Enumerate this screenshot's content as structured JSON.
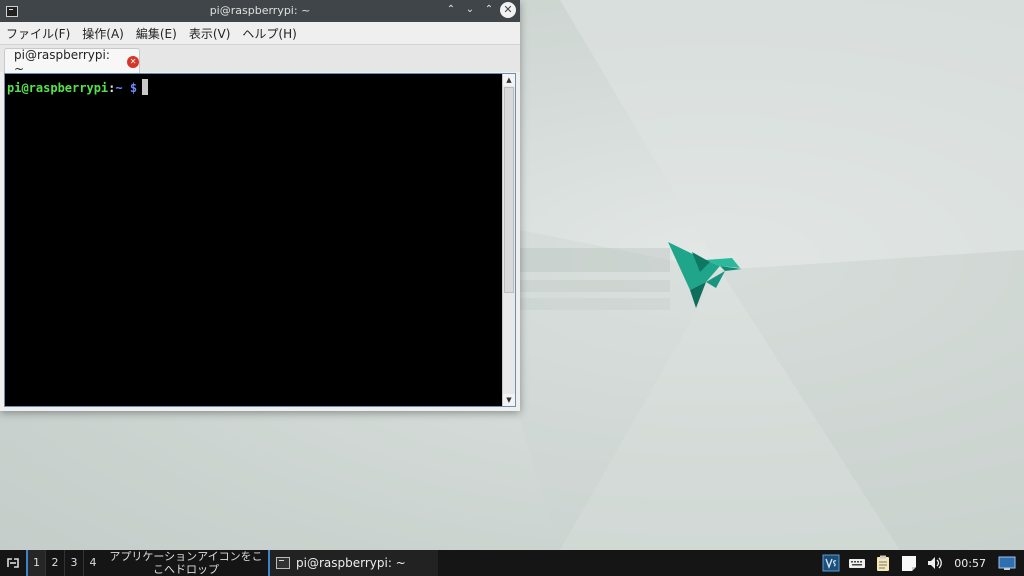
{
  "window": {
    "title": "pi@raspberrypi: ~",
    "controls": {
      "shade": "⌃",
      "minimize": "⌄",
      "maximize": "⌃",
      "close": "✕"
    }
  },
  "menubar": {
    "items": [
      {
        "label": "ファイル(F)"
      },
      {
        "label": "操作(A)"
      },
      {
        "label": "編集(E)"
      },
      {
        "label": "表示(V)"
      },
      {
        "label": "ヘルプ(H)"
      }
    ]
  },
  "tabs": [
    {
      "label": "pi@raspberrypi: ~",
      "close_icon": "✕"
    }
  ],
  "terminal": {
    "prompt_user": "pi@raspberrypi",
    "prompt_sep": ":",
    "prompt_path": "~",
    "prompt_symbol": "$"
  },
  "scrollbar": {
    "up": "▲",
    "down": "▼"
  },
  "taskbar": {
    "desktops": [
      "1",
      "2",
      "3",
      "4"
    ],
    "drop_hint": "アプリケーションアイコンをここへドロップ",
    "task_label": "pi@raspberrypi: ~",
    "clock": "00:57"
  },
  "colors": {
    "titlebar": "#3f4548",
    "prompt_user": "#55e14d",
    "prompt_path": "#6e8bff",
    "accent": "#3d84c6",
    "bird": "#1fa58a"
  },
  "icons": {
    "start_menu": "menu-icon",
    "tray": [
      "vnc-icon",
      "keyboard-icon",
      "clipboard-icon",
      "notes-icon",
      "volume-icon",
      "network-icon"
    ]
  }
}
